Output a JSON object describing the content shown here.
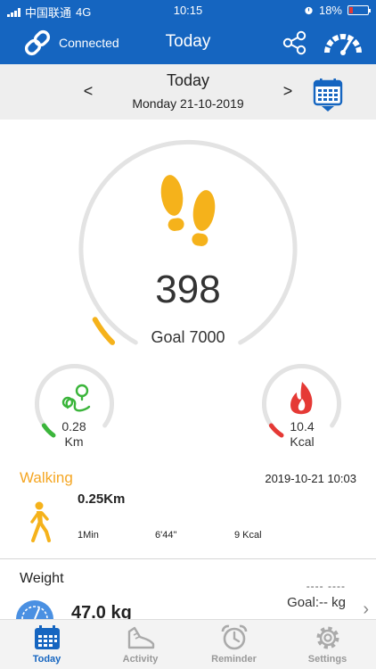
{
  "status_bar": {
    "carrier": "中国联通",
    "network": "4G",
    "time": "10:15",
    "battery": "18%",
    "battery_level": 0.18
  },
  "header": {
    "connection_label": "Connected",
    "title": "Today"
  },
  "date_nav": {
    "prev": "<",
    "next": ">",
    "day_label": "Today",
    "full_date": "Monday 21-10-2019"
  },
  "steps": {
    "value": "398",
    "goal_label": "Goal 7000",
    "progress": 0.057,
    "color": "#f5b21b"
  },
  "distance": {
    "value": "0.28",
    "unit": "Km",
    "color": "#3bb53b"
  },
  "calories": {
    "value": "10.4",
    "unit": "Kcal",
    "color": "#e53935"
  },
  "activity": {
    "title": "Walking",
    "timestamp": "2019-10-21 10:03",
    "distance": "0.25Km",
    "duration": "1Min",
    "pace": "6'44\"",
    "kcal": "9 Kcal"
  },
  "weight": {
    "title": "Weight",
    "value": "47.0 kg",
    "dashes": "---- ----",
    "goal": "Goal:-- kg"
  },
  "tabs": [
    {
      "label": "Today",
      "icon": "calendar-icon",
      "active": true
    },
    {
      "label": "Activity",
      "icon": "shoe-icon",
      "active": false
    },
    {
      "label": "Reminder",
      "icon": "alarm-clock-icon",
      "active": false
    },
    {
      "label": "Settings",
      "icon": "gear-icon",
      "active": false
    }
  ],
  "colors": {
    "primary": "#1565c0",
    "steps": "#f5b21b",
    "distance": "#3bb53b",
    "calories": "#e53935",
    "ring_track": "#e3e3e3"
  }
}
